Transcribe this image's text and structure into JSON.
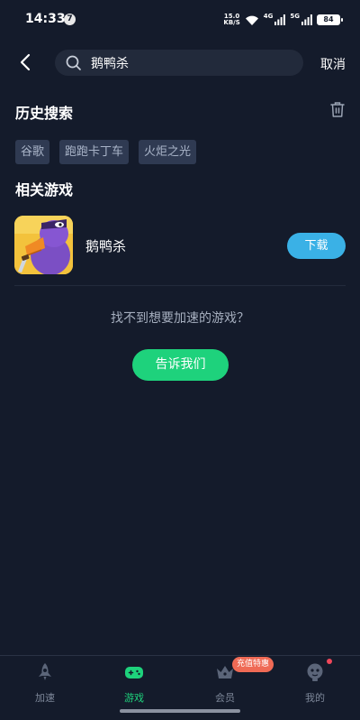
{
  "status_bar": {
    "time": "14:33",
    "notification_count": "7",
    "net_speed_value": "15.0",
    "net_speed_unit": "KB/S",
    "signal_1_label": "4G",
    "signal_2_label": "5G",
    "battery": "84"
  },
  "search": {
    "value": "鹅鸭杀",
    "cancel_label": "取消"
  },
  "history": {
    "title": "历史搜索",
    "tags": [
      "谷歌",
      "跑跑卡丁车",
      "火炬之光"
    ]
  },
  "related": {
    "title": "相关游戏",
    "games": [
      {
        "name": "鹅鸭杀",
        "download_label": "下载"
      }
    ]
  },
  "not_found": {
    "text": "找不到想要加速的游戏？",
    "button_label": "告诉我们"
  },
  "bottom_nav": {
    "items": [
      {
        "label": "加速",
        "icon": "rocket-icon"
      },
      {
        "label": "游戏",
        "icon": "gamepad-icon",
        "active": true
      },
      {
        "label": "会员",
        "icon": "crown-icon"
      },
      {
        "label": "我的",
        "icon": "profile-icon"
      }
    ],
    "promo_badge": "充值特惠"
  },
  "colors": {
    "background": "#141b2b",
    "accent_green": "#1ed27c",
    "download_blue": "#3ab1e6",
    "tag_bg": "#2f3a52"
  }
}
